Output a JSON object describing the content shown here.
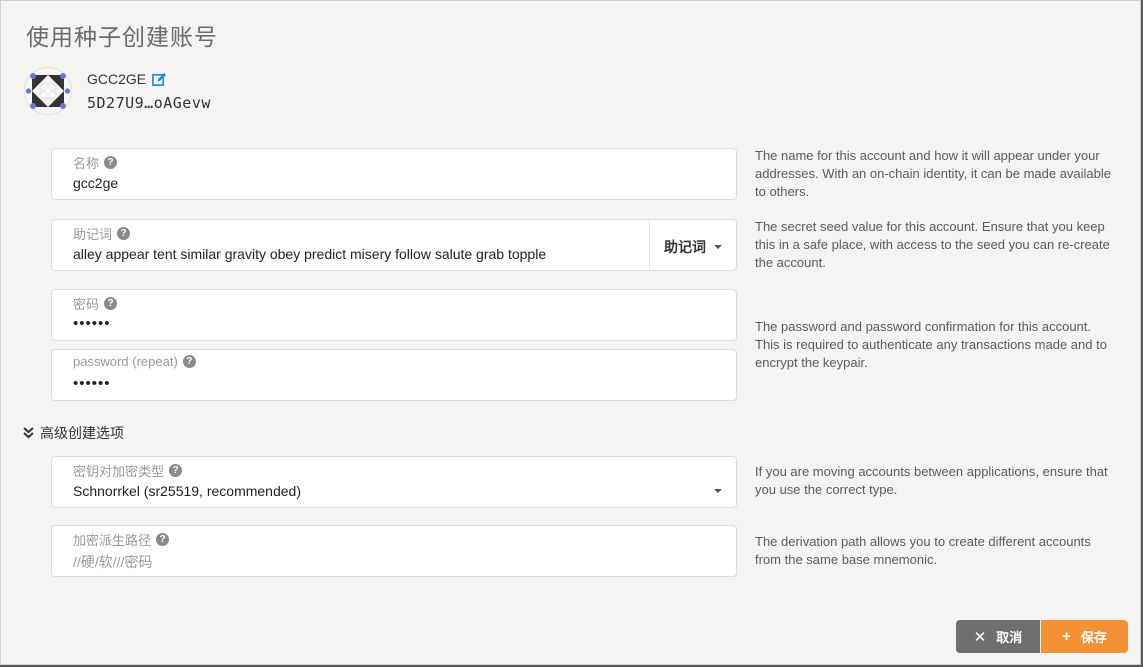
{
  "modal": {
    "title": "使用种子创建账号"
  },
  "account": {
    "name": "GCC2GE",
    "address": "5D27U9…oAGevw"
  },
  "fields": {
    "name": {
      "label": "名称",
      "value": "gcc2ge",
      "help": "The name for this account and how it will appear under your addresses. With an on-chain identity, it can be made available to others."
    },
    "seed": {
      "label": "助记词",
      "value": "alley appear tent similar gravity obey predict misery follow salute grab topple",
      "type_label": "助记词",
      "help": "The secret seed value for this account. Ensure that you keep this in a safe place, with access to the seed you can re-create the account."
    },
    "password": {
      "label": "密码",
      "value": "••••••"
    },
    "password_repeat": {
      "label": "password (repeat)",
      "value": "••••••"
    },
    "password_help": "The password and password confirmation for this account. This is required to authenticate any transactions made and to encrypt the keypair.",
    "crypto": {
      "label": "密钥对加密类型",
      "value": "Schnorrkel (sr25519, recommended)",
      "help": "If you are moving accounts between applications, ensure that you use the correct type."
    },
    "derivation": {
      "label": "加密派生路径",
      "placeholder": "//硬/软///密码",
      "help": "The derivation path allows you to create different accounts from the same base mnemonic."
    }
  },
  "advanced": {
    "label": "高级创建选项"
  },
  "buttons": {
    "cancel": "取消",
    "save": "保存"
  },
  "icons": {
    "help": "?",
    "cancel": "✕",
    "save": "+"
  },
  "colors": {
    "accent": "#f39234",
    "cancel": "#6e6e6e",
    "edit": "#1e8fd6"
  }
}
